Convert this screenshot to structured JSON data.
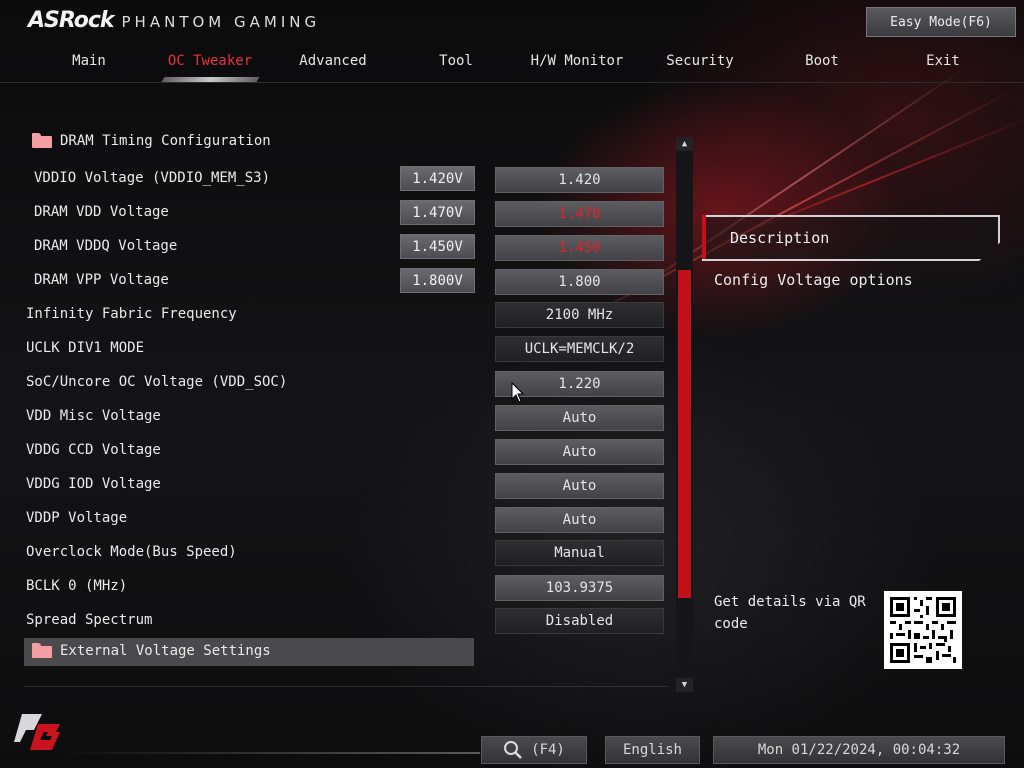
{
  "brand": {
    "name": "ASRock",
    "subtitle": "PHANTOM GAMING"
  },
  "easy_mode_label": "Easy Mode(F6)",
  "tabs": [
    {
      "label": "Main"
    },
    {
      "label": "OC Tweaker",
      "active": true
    },
    {
      "label": "Advanced"
    },
    {
      "label": "Tool"
    },
    {
      "label": "H/W Monitor"
    },
    {
      "label": "Security"
    },
    {
      "label": "Boot"
    },
    {
      "label": "Exit"
    }
  ],
  "section_header": "DRAM Timing Configuration",
  "voltage_rows": [
    {
      "label": "VDDIO Voltage (VDDIO_MEM_S3)",
      "current": "1.420V",
      "value": "1.420",
      "highlight": false
    },
    {
      "label": "DRAM VDD Voltage",
      "current": "1.470V",
      "value": "1.470",
      "highlight": true
    },
    {
      "label": "DRAM VDDQ Voltage",
      "current": "1.450V",
      "value": "1.450",
      "highlight": true
    },
    {
      "label": "DRAM VPP Voltage",
      "current": "1.800V",
      "value": "1.800",
      "highlight": false
    }
  ],
  "setting_rows": [
    {
      "label": "Infinity Fabric Frequency",
      "value": "2100 MHz",
      "style": "dark"
    },
    {
      "label": "UCLK DIV1 MODE",
      "value": "UCLK=MEMCLK/2",
      "style": "dark"
    },
    {
      "label": "SoC/Uncore OC Voltage (VDD_SOC)",
      "value": "1.220",
      "style": "light"
    },
    {
      "label": "VDD Misc Voltage",
      "value": "Auto",
      "style": "light"
    },
    {
      "label": "VDDG CCD Voltage",
      "value": "Auto",
      "style": "light"
    },
    {
      "label": "VDDG IOD Voltage",
      "value": "Auto",
      "style": "light"
    },
    {
      "label": "VDDP Voltage",
      "value": "Auto",
      "style": "light"
    },
    {
      "label": "Overclock Mode(Bus Speed)",
      "value": "Manual",
      "style": "dark"
    },
    {
      "label": "BCLK 0 (MHz)",
      "value": "103.9375",
      "style": "light"
    },
    {
      "label": "Spread Spectrum",
      "value": "Disabled",
      "style": "dark"
    }
  ],
  "selected_item": "External Voltage Settings",
  "description": {
    "title": "Description",
    "text": "Config Voltage options",
    "qr_text": "Get details via QR code"
  },
  "footer": {
    "search_label": "(F4)",
    "language": "English",
    "datetime": "Mon 01/22/2024, 00:04:32"
  },
  "colors": {
    "accent": "#e0222c",
    "scroll_thumb": "#c1121b"
  }
}
